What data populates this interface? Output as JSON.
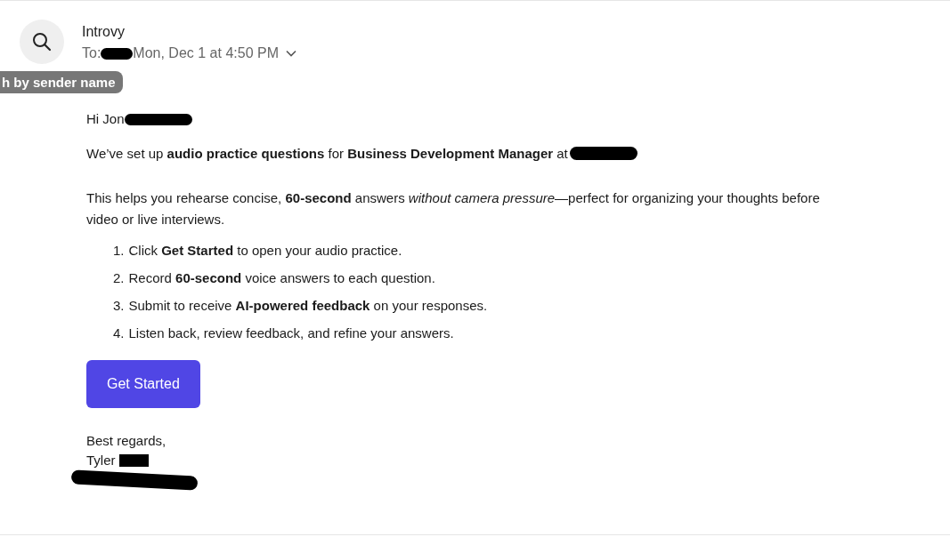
{
  "header": {
    "sender": "Introvy",
    "to_label": "To:",
    "date": "Mon, Dec 1 at 4:50 PM",
    "tooltip": "h by sender name"
  },
  "greeting": "Hi Jon",
  "paragraphs": [
    "We’ve set up **audio practice questions** for **Business Development Manager** at",
    "This helps you rehearse concise, **60-second** answers *without camera pressure*—perfect for organizing your thoughts before video or live interviews."
  ],
  "steps": [
    {
      "number": "1.",
      "text": "Click **Get Started** to open your audio practice."
    },
    {
      "number": "2.",
      "text": "Record **60-second** voice answers to each question."
    },
    {
      "number": "3.",
      "text": "Submit to receive **AI-powered feedback** on your responses."
    },
    {
      "number": "4.",
      "text": "Listen back, review feedback, and refine your answers."
    }
  ],
  "button": "Get Started",
  "closing": "Best regards,",
  "signature": "Tyler"
}
